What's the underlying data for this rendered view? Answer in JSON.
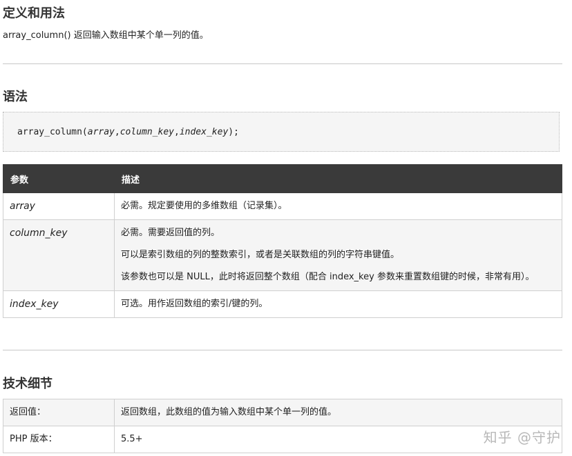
{
  "definition": {
    "title": "定义和用法",
    "intro": "array_column() 返回输入数组中某个单一列的值。"
  },
  "syntax": {
    "title": "语法",
    "code_fn": "array_column(",
    "code_p1": "array",
    "code_sep1": ",",
    "code_p2": "column_key",
    "code_sep2": ",",
    "code_p3": "index_key",
    "code_end": ");"
  },
  "params": {
    "headers": [
      "参数",
      "描述"
    ],
    "rows": [
      {
        "name": "array",
        "desc": [
          "必需。规定要使用的多维数组（记录集）。"
        ]
      },
      {
        "name": "column_key",
        "desc": [
          "必需。需要返回值的列。",
          "可以是索引数组的列的整数索引，或者是关联数组的列的字符串键值。",
          "该参数也可以是 NULL，此时将返回整个数组（配合 index_key 参数来重置数组键的时候，非常有用）。"
        ]
      },
      {
        "name": "index_key",
        "desc": [
          "可选。用作返回数组的索引/键的列。"
        ]
      }
    ]
  },
  "tech": {
    "title": "技术细节",
    "rows": [
      {
        "label": "返回值：",
        "value": "返回数组，此数组的值为输入数组中某个单一列的值。"
      },
      {
        "label": "PHP 版本：",
        "value": "5.5+"
      }
    ]
  },
  "watermark": "知乎 @守护"
}
